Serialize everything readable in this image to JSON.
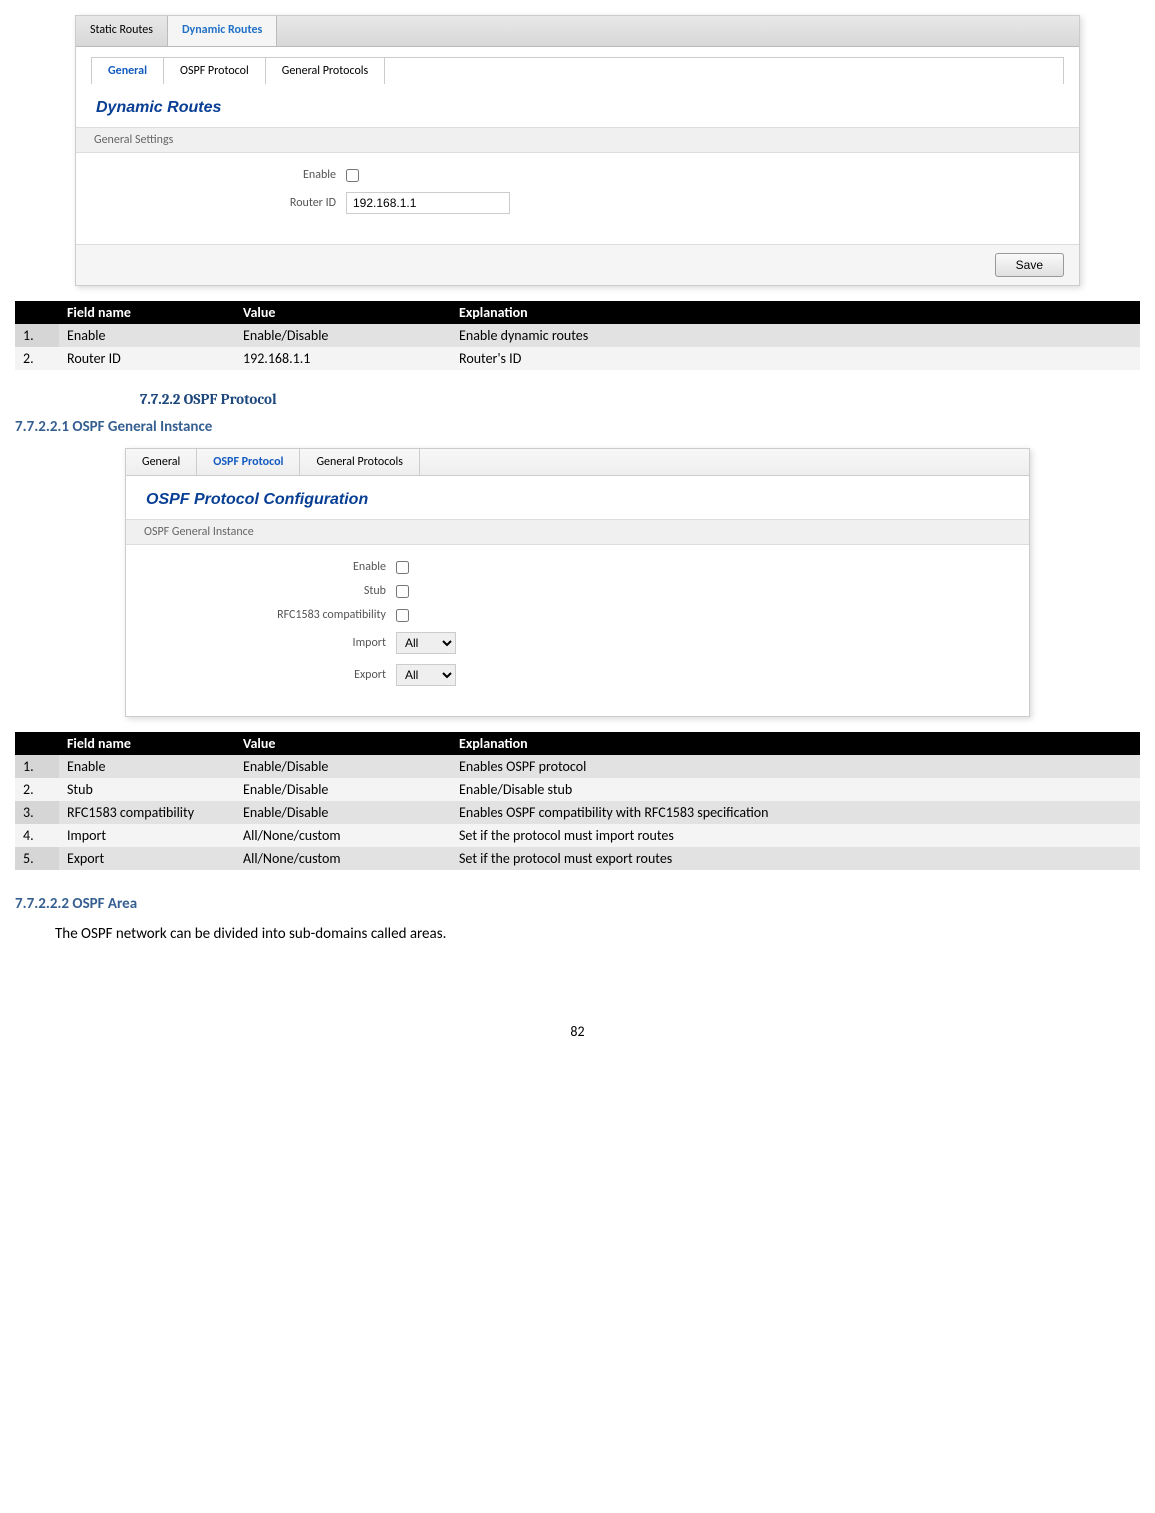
{
  "screenshot1": {
    "topTabs": [
      {
        "label": "Static Routes",
        "active": false
      },
      {
        "label": "Dynamic Routes",
        "active": true
      }
    ],
    "subTabs": [
      {
        "label": "General",
        "active": true
      },
      {
        "label": "OSPF Protocol",
        "active": false
      },
      {
        "label": "General Protocols",
        "active": false
      }
    ],
    "title": "Dynamic Routes",
    "sectionHeader": "General Settings",
    "fields": {
      "enableLabel": "Enable",
      "routerIdLabel": "Router ID",
      "routerIdValue": "192.168.1.1"
    },
    "saveLabel": "Save"
  },
  "table1": {
    "headers": [
      "",
      "Field name",
      "Value",
      "Explanation"
    ],
    "rows": [
      {
        "n": "1.",
        "field": "Enable",
        "value": "Enable/Disable",
        "expl": "Enable dynamic routes"
      },
      {
        "n": "2.",
        "field": "Router ID",
        "value": "192.168.1.1",
        "expl": "Router's ID"
      }
    ]
  },
  "heading_7_7_2_2": "7.7.2.2    OSPF Protocol",
  "heading_7_7_2_2_1": "7.7.2.2.1   OSPF General Instance",
  "screenshot2": {
    "subTabs": [
      {
        "label": "General",
        "active": false
      },
      {
        "label": "OSPF Protocol",
        "active": true
      },
      {
        "label": "General Protocols",
        "active": false
      }
    ],
    "title": "OSPF Protocol Configuration",
    "sectionHeader": "OSPF General Instance",
    "fields": {
      "enableLabel": "Enable",
      "stubLabel": "Stub",
      "rfcLabel": "RFC1583 compatibility",
      "importLabel": "Import",
      "importValue": "All",
      "exportLabel": "Export",
      "exportValue": "All"
    }
  },
  "table2": {
    "headers": [
      "",
      "Field name",
      "Value",
      "Explanation"
    ],
    "rows": [
      {
        "n": "1.",
        "field": "Enable",
        "value": "Enable/Disable",
        "expl": "Enables OSPF protocol"
      },
      {
        "n": "2.",
        "field": "Stub",
        "value": "Enable/Disable",
        "expl": "Enable/Disable stub"
      },
      {
        "n": "3.",
        "field": "RFC1583 compatibility",
        "value": "Enable/Disable",
        "expl": "Enables OSPF compatibility with RFC1583 specification"
      },
      {
        "n": "4.",
        "field": "Import",
        "value": "All/None/custom",
        "expl": "Set if the protocol must import routes"
      },
      {
        "n": "5.",
        "field": "Export",
        "value": "All/None/custom",
        "expl": "Set if the protocol must export routes"
      }
    ]
  },
  "heading_7_7_2_2_2": "7.7.2.2.2   OSPF Area",
  "ospfAreaText": "The OSPF network can be divided into sub-domains called areas.",
  "pageNumber": "82"
}
